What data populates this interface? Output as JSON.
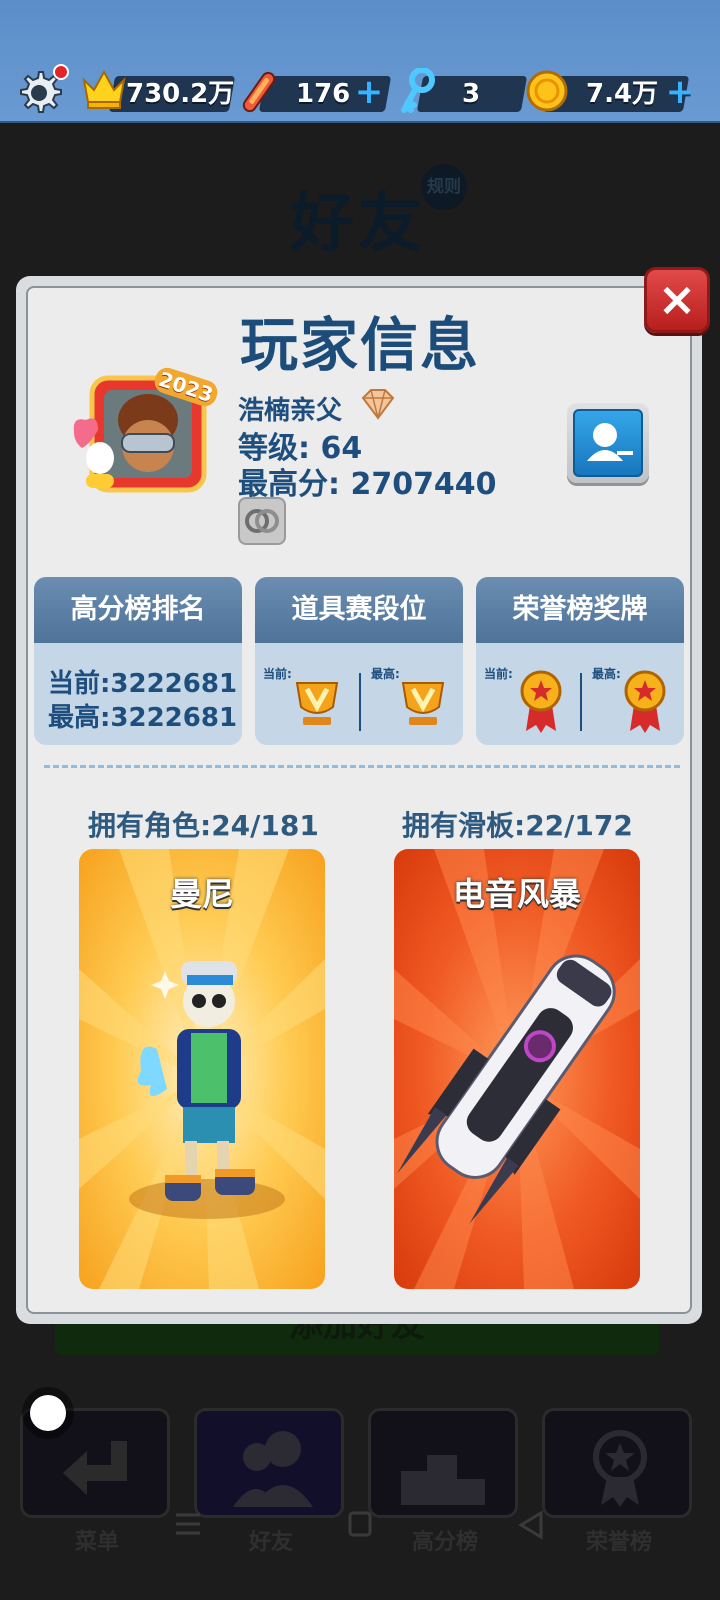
{
  "topbar": {
    "score_value": "730.2万",
    "boards_value": "176",
    "keys_value": "3",
    "coins_value": "7.4万",
    "plus_label": "+"
  },
  "background": {
    "title": "好友",
    "rules_badge": "规则",
    "add_friend_label": "添加好友",
    "nav": [
      "菜单",
      "好友",
      "高分榜",
      "荣誉榜"
    ]
  },
  "modal": {
    "title": "玩家信息",
    "close_label": "×",
    "avatar_frame_year": "2023",
    "player_name": "浩楠亲父",
    "level": "等级: 64",
    "high_score": "最高分: 2707440",
    "stats": [
      {
        "title": "高分榜排名",
        "current": "当前:3222681",
        "best": "最高:3222681"
      },
      {
        "title": "道具赛段位",
        "current_label": "当前:",
        "best_label": "最高:"
      },
      {
        "title": "荣誉榜奖牌",
        "current_label": "当前:",
        "best_label": "最高:"
      }
    ],
    "owned_characters": "拥有角色:24/181",
    "owned_boards": "拥有滑板:22/172",
    "character_card_name": "曼尼",
    "board_card_name": "电音风暴"
  },
  "icons": [
    "gear-icon",
    "crown-icon",
    "hoverboard-icon",
    "key-icon",
    "coin-icon",
    "diamond-rank-icon",
    "rings-icon",
    "profile-icon",
    "trophy-icon",
    "medal-icon",
    "back-arrow-icon",
    "friends-icon",
    "podium-icon",
    "honor-badge-icon"
  ],
  "colors": {
    "primary_text": "#1d4e7d",
    "topbar": "#6a9ad2",
    "close_button": "#d23434",
    "character_card": "#f5a623",
    "board_card": "#e04a15"
  }
}
